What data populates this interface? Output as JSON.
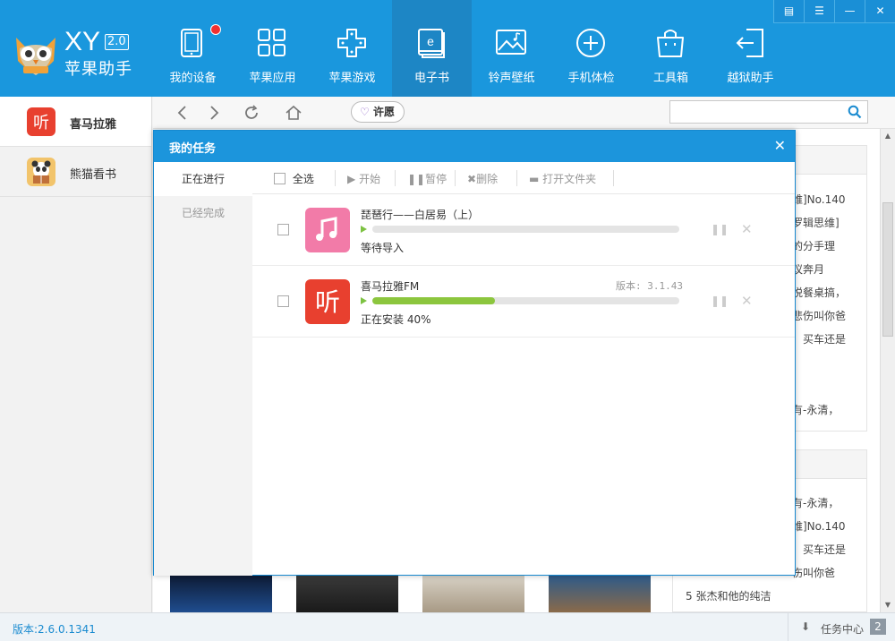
{
  "app": {
    "logo_text": "XY",
    "logo_version": "2.0",
    "logo_name": "苹果助手"
  },
  "nav": [
    {
      "label": "我的设备",
      "icon": "tablet-icon",
      "badge": true
    },
    {
      "label": "苹果应用",
      "icon": "apps-grid-icon"
    },
    {
      "label": "苹果游戏",
      "icon": "gamepad-icon"
    },
    {
      "label": "电子书",
      "icon": "ebook-icon",
      "active": true
    },
    {
      "label": "铃声壁纸",
      "icon": "wallpaper-icon"
    },
    {
      "label": "手机体检",
      "icon": "health-check-icon"
    },
    {
      "label": "工具箱",
      "icon": "toolbox-icon"
    },
    {
      "label": "越狱助手",
      "icon": "jailbreak-icon"
    }
  ],
  "window_controls": [
    "menu-icon",
    "skin-icon",
    "minimize-icon",
    "close-icon"
  ],
  "sidebar": [
    {
      "label": "喜马拉雅",
      "active": true
    },
    {
      "label": "熊猫看书"
    }
  ],
  "toolbar": {
    "wish_label": "许愿",
    "search_placeholder": ""
  },
  "background_text": [
    "维]No.140",
    "罗辑思维]",
    "的分手理",
    "议奔月",
    "悦餐桌搞，",
    "悲伤叫你爸",
    "，买车还是",
    "有-永清，",
    "有-永清，",
    "维]No.140",
    "，买车还是",
    "伤叫你爸",
    "5   张杰和他的纯洁"
  ],
  "modal": {
    "title": "我的任务",
    "tabs": [
      "正在进行",
      "已经完成"
    ],
    "toolbar": {
      "select_all": "全选",
      "start": "开始",
      "pause": "暂停",
      "delete": "删除",
      "open_folder": "打开文件夹"
    },
    "tasks": [
      {
        "name": "琵琶行——白居易（上）",
        "version": "",
        "status": "等待导入",
        "progress": 0
      },
      {
        "name": "喜马拉雅FM",
        "version": "版本: 3.1.43",
        "status": "正在安装 40%",
        "progress": 40
      }
    ]
  },
  "statusbar": {
    "version": "版本:2.6.0.1341",
    "task_center": "任务中心",
    "task_count": "2"
  },
  "colors": {
    "header": "#1a97dd",
    "active_nav": "#1d86c5",
    "progress": "#8cc63e",
    "ximalaya_red": "#e8402f",
    "music_pink": "#f27ba8"
  }
}
